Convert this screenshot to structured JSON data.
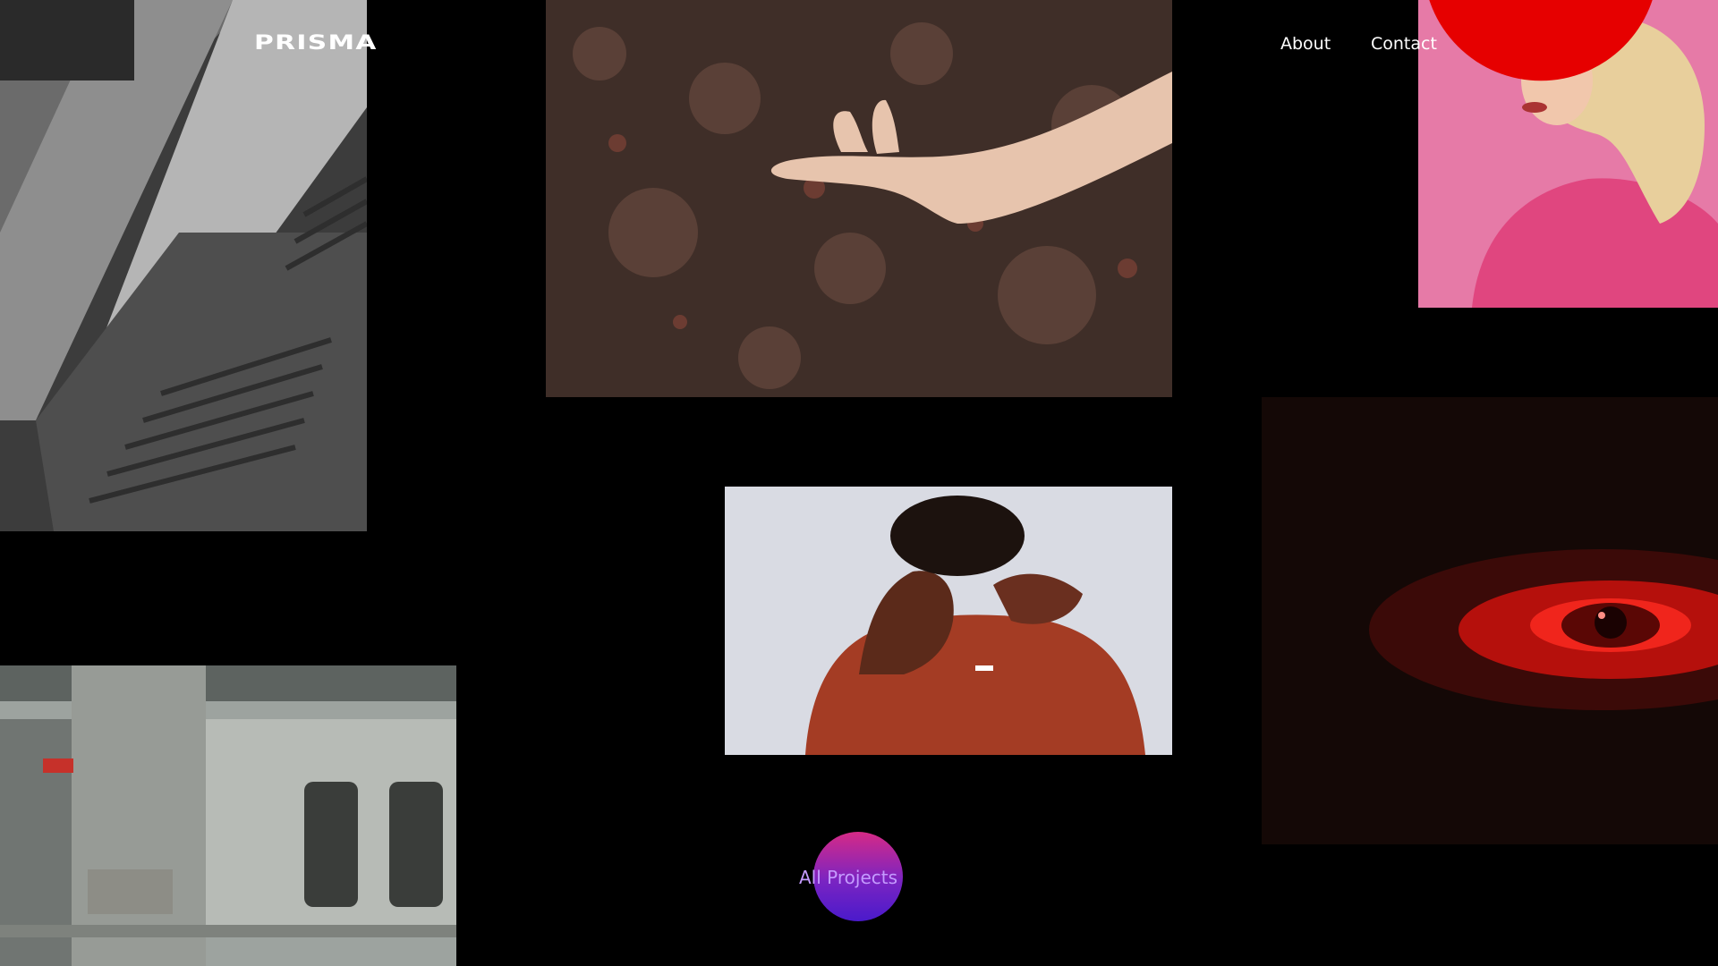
{
  "brand": {
    "logo": "PRISMA"
  },
  "nav": {
    "items": [
      "About",
      "Contact"
    ]
  },
  "cta": {
    "label": "All Projects",
    "color": "#7a24c2"
  },
  "colors": {
    "background": "#000000",
    "accent_red": "#e60000",
    "cta_text": "#c59bff"
  },
  "gallery": [
    {
      "subject": "stairs"
    },
    {
      "subject": "hand-soil"
    },
    {
      "subject": "pink-top"
    },
    {
      "subject": "red-eye"
    },
    {
      "subject": "red-suit"
    },
    {
      "subject": "subway-train"
    }
  ]
}
